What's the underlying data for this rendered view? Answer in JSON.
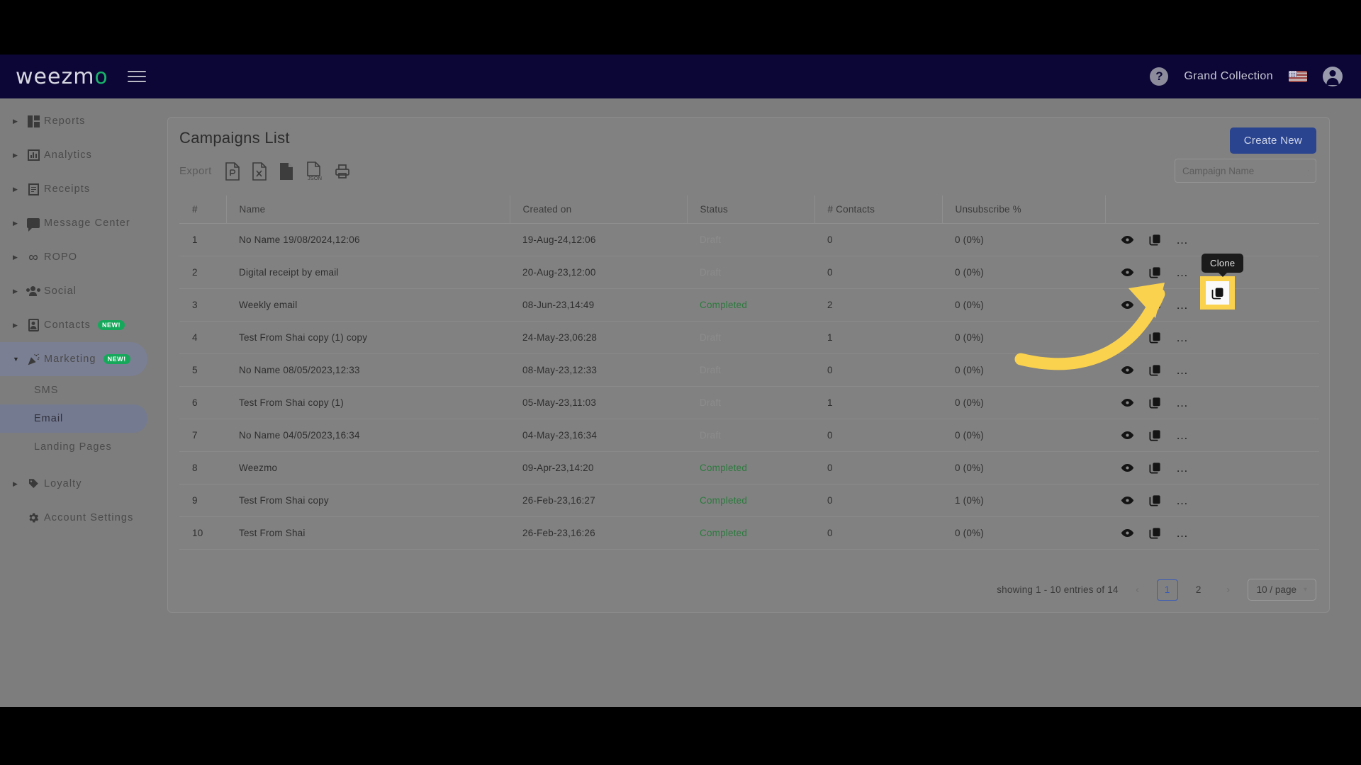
{
  "topnav": {
    "logo_text": "weezm",
    "logo_accent": "o",
    "menu_icon": "hamburger-icon",
    "help_icon": "?",
    "account_name": "Grand Collection",
    "flag": "us-flag",
    "avatar_icon": "account-circle-icon"
  },
  "sidebar": {
    "items": [
      {
        "label": "Reports",
        "icon": "reports-icon",
        "expandable": true,
        "badge": ""
      },
      {
        "label": "Analytics",
        "icon": "analytics-icon",
        "expandable": true,
        "badge": ""
      },
      {
        "label": "Receipts",
        "icon": "receipts-icon",
        "expandable": true,
        "badge": ""
      },
      {
        "label": "Message Center",
        "icon": "message-icon",
        "expandable": true,
        "badge": ""
      },
      {
        "label": "ROPO",
        "icon": "ropo-icon",
        "expandable": true,
        "badge": ""
      },
      {
        "label": "Social",
        "icon": "social-icon",
        "expandable": true,
        "badge": ""
      },
      {
        "label": "Contacts",
        "icon": "contacts-icon",
        "expandable": true,
        "badge": "NEW!"
      },
      {
        "label": "Marketing",
        "icon": "marketing-icon",
        "expandable": true,
        "badge": "NEW!"
      }
    ],
    "marketing_children": [
      {
        "label": "SMS",
        "active": false
      },
      {
        "label": "Email",
        "active": true
      },
      {
        "label": "Landing Pages",
        "active": false
      }
    ],
    "items_after": [
      {
        "label": "Loyalty",
        "icon": "loyalty-icon",
        "expandable": true,
        "badge": ""
      },
      {
        "label": "Account Settings",
        "icon": "gear-icon",
        "expandable": false,
        "badge": ""
      }
    ]
  },
  "card": {
    "title": "Campaigns List",
    "create_button": "Create New",
    "export_label": "Export",
    "export_icons": [
      "pdf-icon",
      "excel-icon",
      "csv-icon",
      "json-icon",
      "print-icon"
    ],
    "search": {
      "placeholder": "Campaign Name",
      "value": "",
      "icon": "search-icon"
    }
  },
  "table": {
    "columns": [
      "#",
      "Name",
      "Created on",
      "Status",
      "# Contacts",
      "Unsubscribe %",
      ""
    ],
    "rows": [
      {
        "num": "1",
        "name": "No Name 19/08/2024,12:06",
        "created": "19-Aug-24,12:06",
        "status": "Draft",
        "contacts": "0",
        "unsub": "0 (0%)"
      },
      {
        "num": "2",
        "name": "Digital receipt by email",
        "created": "20-Aug-23,12:00",
        "status": "Draft",
        "contacts": "0",
        "unsub": "0 (0%)"
      },
      {
        "num": "3",
        "name": "Weekly email",
        "created": "08-Jun-23,14:49",
        "status": "Completed",
        "contacts": "2",
        "unsub": "0 (0%)"
      },
      {
        "num": "4",
        "name": "Test From Shai copy (1) copy",
        "created": "24-May-23,06:28",
        "status": "Draft",
        "contacts": "1",
        "unsub": "0 (0%)"
      },
      {
        "num": "5",
        "name": "No Name 08/05/2023,12:33",
        "created": "08-May-23,12:33",
        "status": "Draft",
        "contacts": "0",
        "unsub": "0 (0%)"
      },
      {
        "num": "6",
        "name": "Test From Shai copy (1)",
        "created": "05-May-23,11:03",
        "status": "Draft",
        "contacts": "1",
        "unsub": "0 (0%)"
      },
      {
        "num": "7",
        "name": "No Name 04/05/2023,16:34",
        "created": "04-May-23,16:34",
        "status": "Draft",
        "contacts": "0",
        "unsub": "0 (0%)"
      },
      {
        "num": "8",
        "name": "Weezmo",
        "created": "09-Apr-23,14:20",
        "status": "Completed",
        "contacts": "0",
        "unsub": "0 (0%)"
      },
      {
        "num": "9",
        "name": "Test From Shai copy",
        "created": "26-Feb-23,16:27",
        "status": "Completed",
        "contacts": "0",
        "unsub": "1 (0%)"
      },
      {
        "num": "10",
        "name": "Test From Shai",
        "created": "26-Feb-23,16:26",
        "status": "Completed",
        "contacts": "0",
        "unsub": "0 (0%)"
      }
    ],
    "row_actions": [
      "preview-eye-icon",
      "clone-icon",
      "more-options-icon"
    ]
  },
  "pagination": {
    "summary": "showing 1 - 10 entries of 14",
    "prev": "‹",
    "pages": [
      "1",
      "2"
    ],
    "active_page": "1",
    "next": "›",
    "page_size": "10 / page",
    "chevron": "∨"
  },
  "annotation": {
    "tooltip": "Clone",
    "highlight_color": "#fbd24e",
    "arrow_color": "#fbd24e"
  },
  "colors": {
    "nav_bg": "#0b0635",
    "accent_green": "#18b26a",
    "primary_blue": "#2b4490",
    "status_completed": "#2d7a3e",
    "status_draft": "#8c8c8c",
    "page_bg": "#7d7d7d"
  }
}
